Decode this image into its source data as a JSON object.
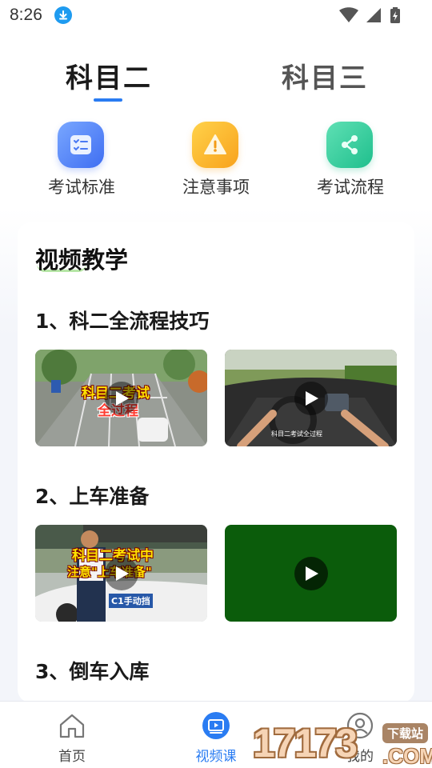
{
  "status_bar": {
    "time": "8:26",
    "download_icon": "download-icon",
    "wifi_icon": "wifi-icon",
    "signal_icon": "signal-icon",
    "battery_icon": "battery-charging-icon"
  },
  "tabs": [
    {
      "label": "科目二",
      "active": true
    },
    {
      "label": "科目三",
      "active": false
    }
  ],
  "quick_items": [
    {
      "label": "考试标准",
      "icon": "checklist-icon",
      "color": "#3f6ef2"
    },
    {
      "label": "注意事项",
      "icon": "warning-icon",
      "color": "#f8a21c"
    },
    {
      "label": "考试流程",
      "icon": "share-icon",
      "color": "#1fbf8d"
    }
  ],
  "card": {
    "title": "视频教学",
    "sections": [
      {
        "title": "1、科二全流程技巧",
        "videos": [
          {
            "caption_top": "科目二考试",
            "caption_bottom": "全过程"
          },
          {
            "caption_small": "科目二考试全过程"
          }
        ]
      },
      {
        "title": "2、上车准备",
        "videos": [
          {
            "caption_top": "科目二考试中",
            "caption_bottom": "注意\"上车准备\"",
            "caption_box": "C1手动挡"
          },
          {}
        ]
      },
      {
        "title": "3、倒车入库"
      }
    ]
  },
  "bottom_nav": [
    {
      "label": "首页",
      "icon": "home-icon",
      "active": false
    },
    {
      "label": "视频课",
      "icon": "video-icon",
      "active": true
    },
    {
      "label": "我的",
      "icon": "user-icon",
      "active": false
    }
  ],
  "watermark": {
    "logo": "17173",
    "tag": "下载站",
    "domain": ".COM"
  },
  "colors": {
    "accent": "#2a7cf2",
    "background": "#f3f5fa",
    "card": "#ffffff"
  }
}
